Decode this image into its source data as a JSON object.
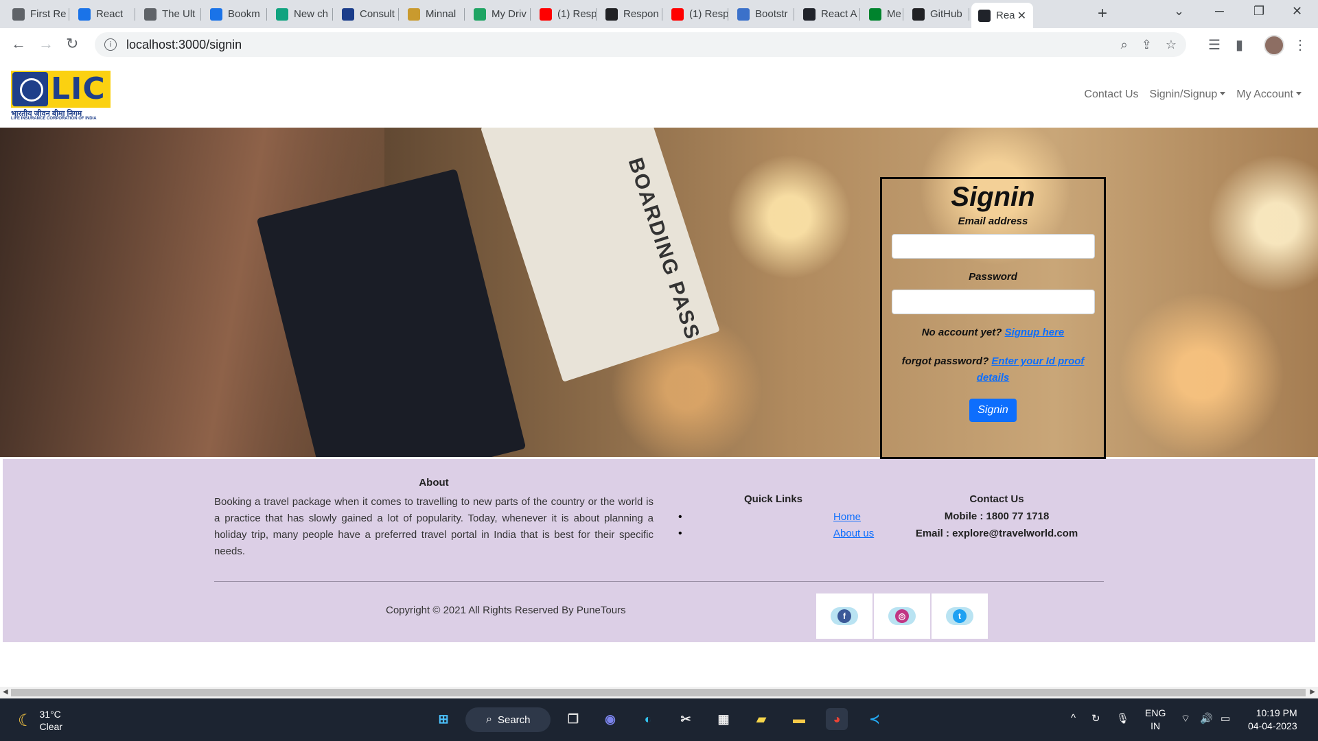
{
  "browser": {
    "tabs": [
      {
        "label": "First Re",
        "icon": "globe-icon",
        "color": "#5f6368"
      },
      {
        "label": "React",
        "icon": "react-icon",
        "color": "#1a73e8"
      },
      {
        "label": "The Ult",
        "icon": "globe-icon",
        "color": "#5f6368"
      },
      {
        "label": "Bookm",
        "icon": "star-icon",
        "color": "#1a73e8"
      },
      {
        "label": "New ch",
        "icon": "chatgpt-icon",
        "color": "#10a37f"
      },
      {
        "label": "Consult",
        "icon": "ahk-icon",
        "color": "#1a3c8a"
      },
      {
        "label": "Minnal",
        "icon": "minnal-icon",
        "color": "#c99a2e"
      },
      {
        "label": "My Driv",
        "icon": "drive-icon",
        "color": "#1fa463"
      },
      {
        "label": "(1) Resp",
        "icon": "youtube-icon",
        "color": "#ff0000"
      },
      {
        "label": "Respon",
        "icon": "respon-icon",
        "color": "#202124"
      },
      {
        "label": "(1) Resp",
        "icon": "youtube-icon",
        "color": "#ff0000"
      },
      {
        "label": "Bootstr",
        "icon": "mdb-icon",
        "color": "#3b71ca"
      },
      {
        "label": "React A",
        "icon": "react-icon",
        "color": "#20232a"
      },
      {
        "label": "Me",
        "icon": "meet-icon",
        "color": "#00832d"
      },
      {
        "label": "GitHub",
        "icon": "github-icon",
        "color": "#202124"
      },
      {
        "label": "Rea",
        "icon": "react-icon",
        "color": "#20232a",
        "active": true
      }
    ],
    "url": "localhost:3000/signin"
  },
  "nav": {
    "logo_text": "LIC",
    "logo_hindi": "भारतीय जीवन बीमा निगम",
    "logo_english": "LIFE INSURANCE CORPORATION OF INDIA",
    "links": [
      "Contact Us",
      "Signin/Signup",
      "My Account"
    ]
  },
  "hero": {
    "ticket_label": "BOARDING PASS"
  },
  "signin": {
    "title": "Signin",
    "email_label": "Email address",
    "email_value": "",
    "password_label": "Password",
    "password_value": "",
    "no_account_text": "No account yet?",
    "signup_link": "Signup here",
    "forgot_text": "forgot password?",
    "forgot_link": "Enter your Id proof details",
    "button": "Signin"
  },
  "footer": {
    "about_title": "About",
    "about_text": "Booking a travel package when it comes to travelling to new parts of the country or the world is a practice that has slowly gained a lot of popularity. Today, whenever it is about planning a holiday trip, many people have a preferred travel portal in India that is best for their specific needs.",
    "quick_title": "Quick Links",
    "quick_links": [
      "Home",
      "About us"
    ],
    "contact_title": "Contact Us",
    "mobile": "Mobile : 1800 77 1718",
    "email": "Email : explore@travelworld.com",
    "copyright": "Copyright © 2021 All Rights Reserved By PuneTours",
    "social": [
      {
        "name": "facebook-icon",
        "glyph": "f",
        "color": "#3b5998"
      },
      {
        "name": "instagram-icon",
        "glyph": "◎",
        "color": "#c13584"
      },
      {
        "name": "twitter-icon",
        "glyph": "t",
        "color": "#1da1f2"
      }
    ]
  },
  "taskbar": {
    "temperature": "31°C",
    "condition": "Clear",
    "search_label": "Search",
    "lang_top": "ENG",
    "lang_bottom": "IN",
    "time": "10:19 PM",
    "date": "04-04-2023"
  }
}
